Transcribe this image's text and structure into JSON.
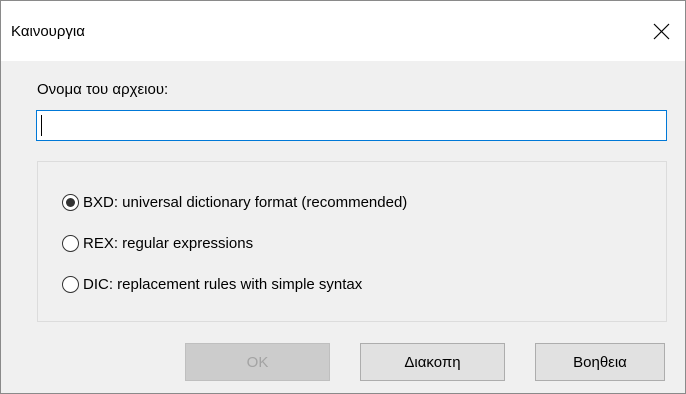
{
  "window": {
    "title": "Καινουργια"
  },
  "filename": {
    "label": "Ονομα του αρχειου:",
    "value": "",
    "placeholder": ""
  },
  "format_options": [
    {
      "label": "BXD: universal dictionary format (recommended)",
      "checked": true
    },
    {
      "label": "REX: regular expressions",
      "checked": false
    },
    {
      "label": "DIC: replacement rules with simple syntax",
      "checked": false
    }
  ],
  "buttons": {
    "ok": "OK",
    "cancel": "Διακοπη",
    "help": "Βοηθεια"
  },
  "icons": {
    "close": "close-icon"
  },
  "colors": {
    "accent": "#0078d7",
    "dialog_bg": "#f0f0f0",
    "disabled_text": "#a3a3a3"
  }
}
